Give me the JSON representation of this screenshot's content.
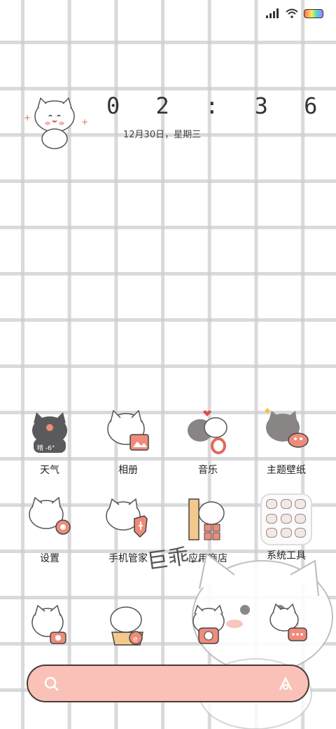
{
  "status_bar": {
    "signal_icon": "signal-bars-icon",
    "wifi_icon": "wifi-icon",
    "battery_icon": "rainbow-battery-icon"
  },
  "clock": {
    "time": "0 2 : 3 6",
    "date": "12月30日，星期三"
  },
  "apps": [
    {
      "id": "weather",
      "label": "天气",
      "badge": "晴 -6°"
    },
    {
      "id": "gallery",
      "label": "相册"
    },
    {
      "id": "music",
      "label": "音乐"
    },
    {
      "id": "themes",
      "label": "主题壁纸"
    },
    {
      "id": "settings",
      "label": "设置"
    },
    {
      "id": "security",
      "label": "手机管家"
    },
    {
      "id": "appstore",
      "label": "应用商店"
    },
    {
      "id": "tools",
      "label": "系统工具"
    }
  ],
  "dock_apps": [
    {
      "id": "phone"
    },
    {
      "id": "browser"
    },
    {
      "id": "camera"
    },
    {
      "id": "messages"
    }
  ],
  "wallpaper_text": "巨乖..",
  "search_bar": {
    "search_icon": "search-icon",
    "assistant_icon": "assistant-icon"
  },
  "colors": {
    "accent": "#f9c1b7",
    "outline": "#4a3b37",
    "cat_pink": "#f08b7a"
  }
}
